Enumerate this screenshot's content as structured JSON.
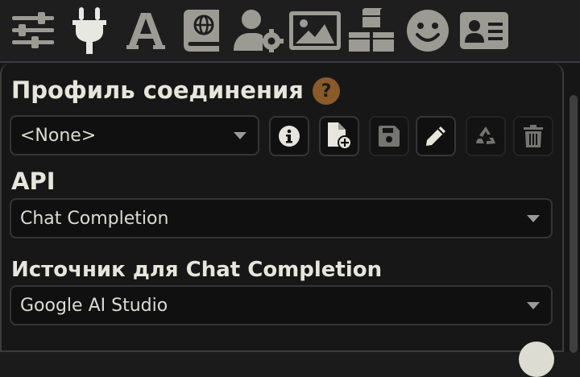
{
  "topbar": {
    "icons": [
      {
        "name": "sliders-icon",
        "active": false
      },
      {
        "name": "plug-icon",
        "active": true
      },
      {
        "name": "font-icon",
        "active": false
      },
      {
        "name": "book-globe-icon",
        "active": false
      },
      {
        "name": "user-gear-icon",
        "active": false
      },
      {
        "name": "image-icon",
        "active": false
      },
      {
        "name": "cubes-icon",
        "active": false
      },
      {
        "name": "smile-icon",
        "active": false
      },
      {
        "name": "id-card-icon",
        "active": false
      }
    ]
  },
  "connection_profile": {
    "title": "Профиль соединения",
    "help_label": "?",
    "selected": "<None>",
    "buttons": [
      {
        "name": "info-button",
        "icon": "info-icon",
        "disabled": false
      },
      {
        "name": "new-profile-button",
        "icon": "file-plus-icon",
        "disabled": false
      },
      {
        "name": "save-button",
        "icon": "floppy-icon",
        "disabled": true
      },
      {
        "name": "rename-button",
        "icon": "pencil-icon",
        "disabled": false
      },
      {
        "name": "reload-button",
        "icon": "recycle-icon",
        "disabled": true
      },
      {
        "name": "delete-button",
        "icon": "trash-icon",
        "disabled": true
      }
    ]
  },
  "api": {
    "title": "API",
    "selected": "Chat Completion"
  },
  "source": {
    "title": "Источник для Chat Completion",
    "selected": "Google AI Studio"
  },
  "colors": {
    "background": "#171717",
    "help_badge": "#8a5a2a",
    "text": "#dcdcd2"
  }
}
